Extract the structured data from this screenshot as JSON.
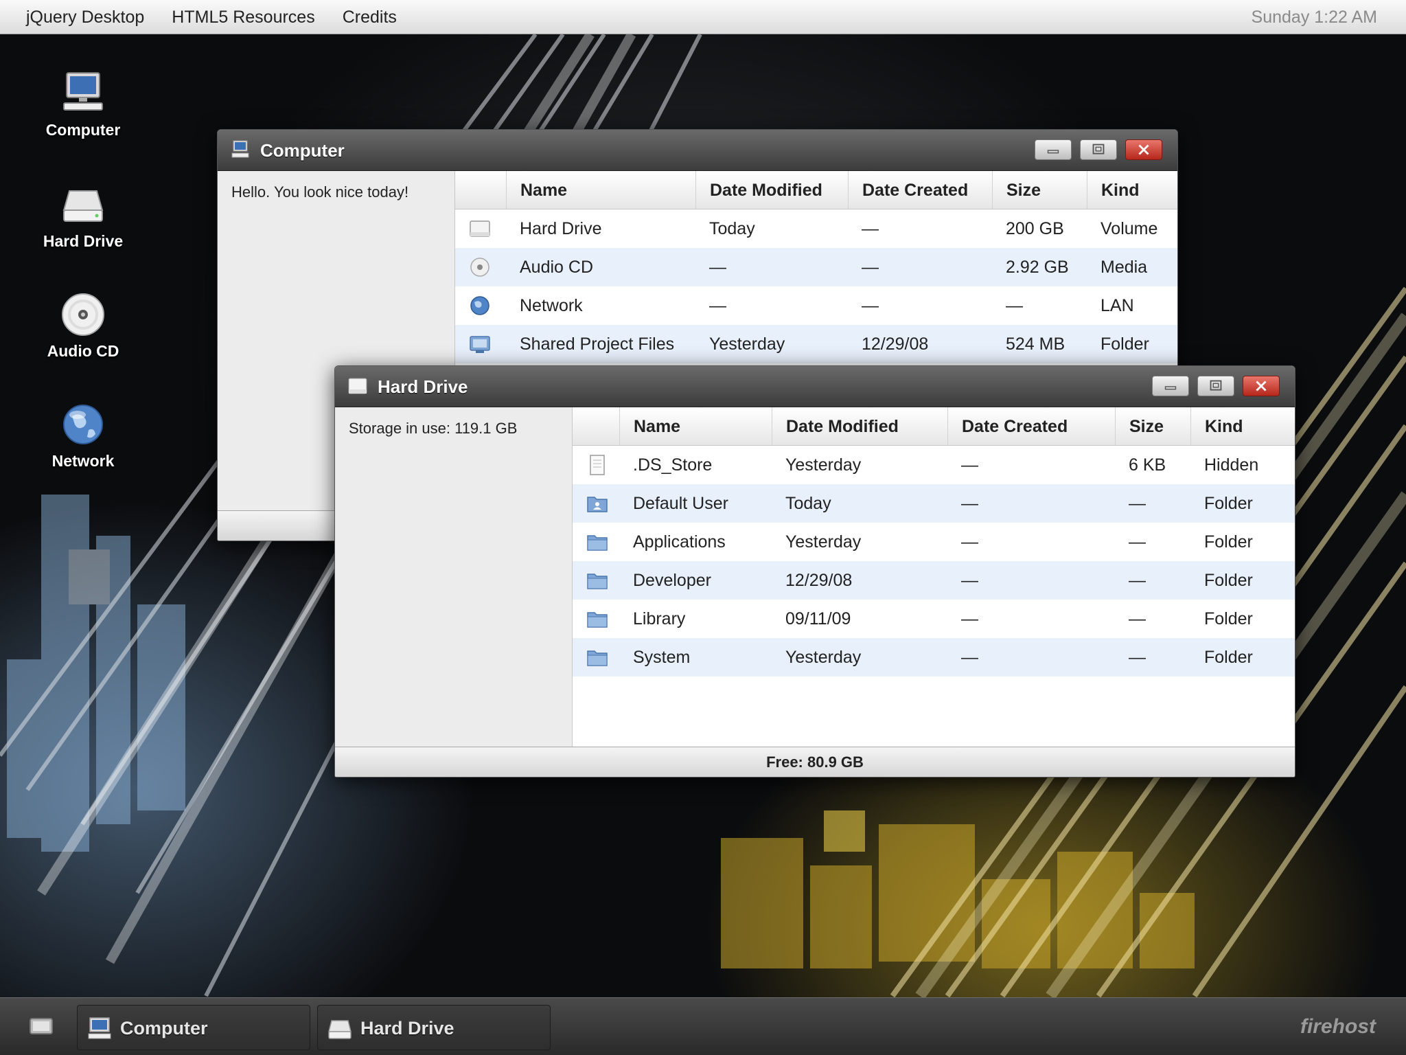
{
  "menubar": {
    "items": [
      "jQuery Desktop",
      "HTML5 Resources",
      "Credits"
    ],
    "clock": "Sunday 1:22 AM"
  },
  "desktop_icons": [
    {
      "label": "Computer",
      "icon": "computer-icon"
    },
    {
      "label": "Hard Drive",
      "icon": "hard-drive-icon"
    },
    {
      "label": "Audio CD",
      "icon": "audio-cd-icon"
    },
    {
      "label": "Network",
      "icon": "network-globe-icon"
    }
  ],
  "window_computer": {
    "title": "Computer",
    "sidebar_text": "Hello. You look nice today!",
    "columns": [
      "Name",
      "Date Modified",
      "Date Created",
      "Size",
      "Kind"
    ],
    "rows": [
      {
        "icon": "hard-drive-icon",
        "name": "Hard Drive",
        "modified": "Today",
        "created": "—",
        "size": "200 GB",
        "kind": "Volume"
      },
      {
        "icon": "audio-cd-icon",
        "name": "Audio CD",
        "modified": "—",
        "created": "—",
        "size": "2.92 GB",
        "kind": "Media"
      },
      {
        "icon": "network-globe-icon",
        "name": "Network",
        "modified": "—",
        "created": "—",
        "size": "—",
        "kind": "LAN"
      },
      {
        "icon": "shared-folder-icon",
        "name": "Shared Project Files",
        "modified": "Yesterday",
        "created": "12/29/08",
        "size": "524 MB",
        "kind": "Folder"
      }
    ]
  },
  "window_harddrive": {
    "title": "Hard Drive",
    "sidebar_text": "Storage in use: 119.1 GB",
    "status": "Free: 80.9 GB",
    "columns": [
      "Name",
      "Date Modified",
      "Date Created",
      "Size",
      "Kind"
    ],
    "rows": [
      {
        "icon": "file-icon",
        "name": ".DS_Store",
        "modified": "Yesterday",
        "created": "—",
        "size": "6 KB",
        "kind": "Hidden"
      },
      {
        "icon": "user-folder-icon",
        "name": "Default User",
        "modified": "Today",
        "created": "—",
        "size": "—",
        "kind": "Folder"
      },
      {
        "icon": "folder-icon",
        "name": "Applications",
        "modified": "Yesterday",
        "created": "—",
        "size": "—",
        "kind": "Folder"
      },
      {
        "icon": "folder-icon",
        "name": "Developer",
        "modified": "12/29/08",
        "created": "—",
        "size": "—",
        "kind": "Folder"
      },
      {
        "icon": "folder-icon",
        "name": "Library",
        "modified": "09/11/09",
        "created": "—",
        "size": "—",
        "kind": "Folder"
      },
      {
        "icon": "folder-icon",
        "name": "System",
        "modified": "Yesterday",
        "created": "—",
        "size": "—",
        "kind": "Folder"
      }
    ]
  },
  "taskbar": {
    "tasks": [
      {
        "label": "Computer",
        "icon": "computer-icon"
      },
      {
        "label": "Hard Drive",
        "icon": "hard-drive-icon"
      }
    ],
    "brand": "firehost"
  },
  "colors": {
    "titlebar": "#4a4a4a",
    "row_alt": "#e8f0fb",
    "close_button": "#c8372a",
    "folder": "#7fa6d6"
  }
}
